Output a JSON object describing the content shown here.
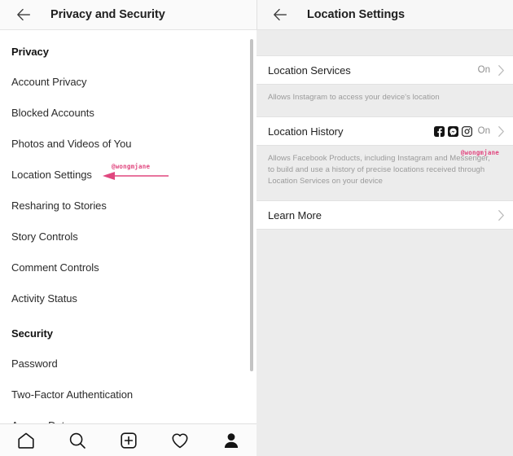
{
  "left_panel": {
    "header": {
      "back_icon": "back-arrow-icon",
      "title": "Privacy and Security"
    },
    "items": [
      {
        "label": "Privacy",
        "type": "section"
      },
      {
        "label": "Account Privacy",
        "type": "item"
      },
      {
        "label": "Blocked Accounts",
        "type": "item"
      },
      {
        "label": "Photos and Videos of You",
        "type": "item"
      },
      {
        "label": "Location Settings",
        "type": "item"
      },
      {
        "label": "Resharing to Stories",
        "type": "item"
      },
      {
        "label": "Story Controls",
        "type": "item"
      },
      {
        "label": "Comment Controls",
        "type": "item"
      },
      {
        "label": "Activity Status",
        "type": "item"
      },
      {
        "label": "Security",
        "type": "section"
      },
      {
        "label": "Password",
        "type": "item"
      },
      {
        "label": "Two-Factor Authentication",
        "type": "item"
      },
      {
        "label": "Access Data",
        "type": "item"
      }
    ],
    "annotation": {
      "label": "@wongmjane",
      "color": "#e0477f",
      "points_to": "Location Settings"
    }
  },
  "right_panel": {
    "header": {
      "back_icon": "back-arrow-icon",
      "title": "Location Settings"
    },
    "rows": [
      {
        "label": "Location Services",
        "value": "On",
        "chevron": "chevron-right-icon",
        "description": "Allows Instagram to access your device's location",
        "icons": []
      },
      {
        "label": "Location History",
        "value": "On",
        "chevron": "chevron-right-icon",
        "description": "Allows Facebook Products, including Instagram and Messenger, to build and use a history of precise locations received through Location Services on your device",
        "icons": [
          "facebook-icon",
          "messenger-icon",
          "instagram-icon"
        ]
      },
      {
        "label": "Learn More",
        "value": "",
        "chevron": "chevron-right-icon",
        "description": "",
        "icons": []
      }
    ],
    "watermark": "@wongmjane"
  },
  "bottom_nav": {
    "items": [
      {
        "name": "home-icon",
        "active": false
      },
      {
        "name": "search-icon",
        "active": false
      },
      {
        "name": "add-post-icon",
        "active": false
      },
      {
        "name": "heart-icon",
        "active": false
      },
      {
        "name": "profile-icon",
        "active": true
      }
    ]
  },
  "colors": {
    "accent_pink": "#e0477f",
    "page_bg": "#ececec",
    "card_bg": "#ffffff",
    "header_bg": "#fafafa",
    "text_primary": "#1f1f1f",
    "text_muted": "#9a9a9a"
  }
}
